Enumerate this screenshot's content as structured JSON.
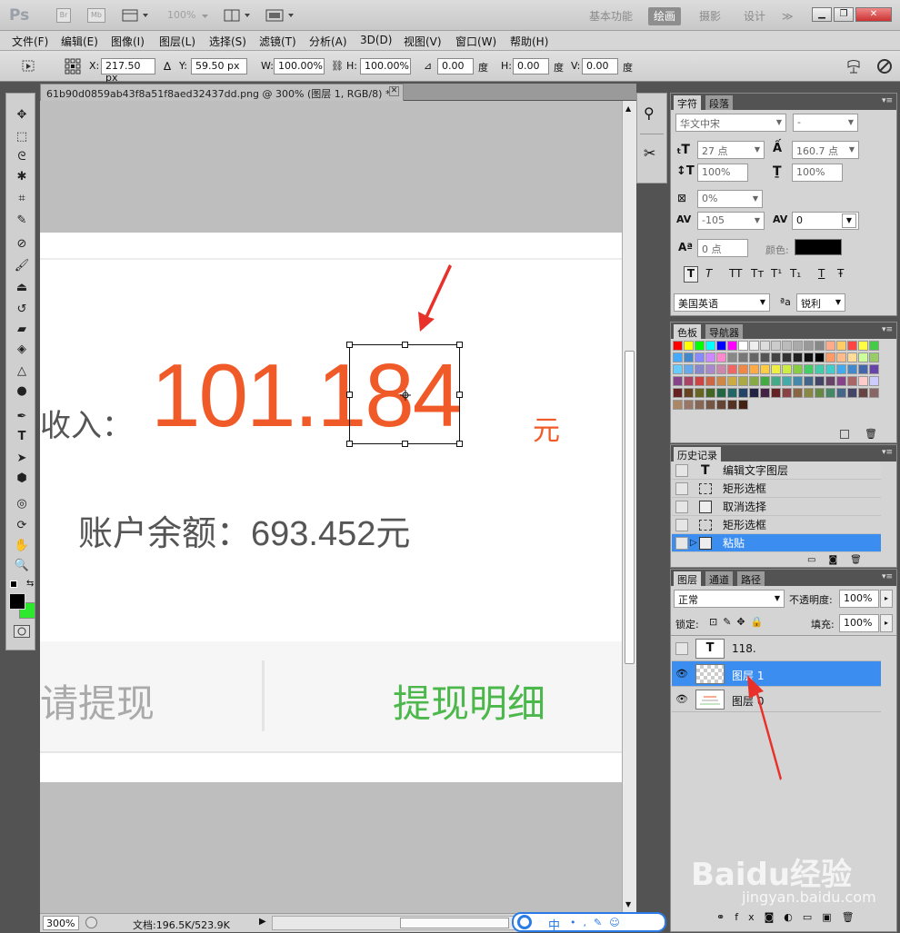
{
  "app": {
    "logo": "Ps",
    "br": "Br",
    "mb": "Mb",
    "zoom_display": "100%"
  },
  "workspaces": [
    "基本功能",
    "绘画",
    "摄影",
    "设计"
  ],
  "workspace_more": "≫",
  "menu": [
    "文件(F)",
    "编辑(E)",
    "图像(I)",
    "图层(L)",
    "选择(S)",
    "滤镜(T)",
    "分析(A)",
    "3D(D)",
    "视图(V)",
    "窗口(W)",
    "帮助(H)"
  ],
  "options": {
    "x_label": "X:",
    "x_value": "217.50 px",
    "y_label": "Y:",
    "y_value": "59.50 px",
    "w_label": "W:",
    "w_value": "100.00%",
    "h_label": "H:",
    "h_value": "100.00%",
    "angle_value": "0.00",
    "angle_unit": "度",
    "hskew_label": "H:",
    "hskew_value": "0.00",
    "hskew_unit": "度",
    "vskew_label": "V:",
    "vskew_value": "0.00",
    "vskew_unit": "度"
  },
  "document": {
    "tab_title": "61b90d0859ab43f8a51f8aed32437dd.png @ 300% (图层 1, RGB/8) *",
    "income_label": "收入：",
    "income_value": "101.184",
    "income_unit": "元",
    "balance": "账户余额：693.452元",
    "withdraw": "请提现",
    "withdraw_detail": "提现明细",
    "accent_color": "#f05a28",
    "green_color": "#4cb84c"
  },
  "status": {
    "zoom": "300%",
    "doc_info": "文档:196.5K/523.9K"
  },
  "char_panel": {
    "tabs": [
      "字符",
      "段落"
    ],
    "font_family": "华文中宋",
    "font_style": "-",
    "font_size": "27 点",
    "leading": "160.7 点",
    "v_scale": "100%",
    "h_scale": "100%",
    "tsume": "0%",
    "kerning": "-105",
    "tracking": "0",
    "baseline": "0 点",
    "color_label": "颜色:",
    "style_buttons": [
      "T",
      "T",
      "TT",
      "Tт",
      "T¹",
      "T₁",
      "T",
      "Ŧ"
    ],
    "language": "美国英语",
    "aa_label": "ªa",
    "antialias": "锐利"
  },
  "swatch_panel": {
    "tabs": [
      "色板",
      "导航器"
    ]
  },
  "history_panel": {
    "tabs": [
      "历史记录"
    ],
    "items": [
      "编辑文字图层",
      "矩形选框",
      "取消选择",
      "矩形选框",
      "粘贴"
    ]
  },
  "layers_panel": {
    "tabs": [
      "图层",
      "通道",
      "路径"
    ],
    "blend_mode": "正常",
    "opacity_label": "不透明度:",
    "opacity": "100%",
    "lock_label": "锁定:",
    "fill_label": "填充:",
    "fill": "100%",
    "layers": [
      "118.",
      "图层 1",
      "图层 0"
    ]
  },
  "watermark": {
    "brand": "Baidu经验",
    "url": "jingyan.baidu.com"
  },
  "ime": {
    "label": "中"
  }
}
